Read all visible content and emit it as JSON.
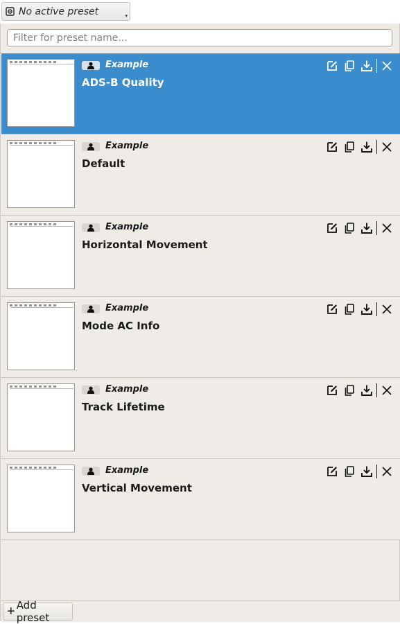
{
  "header": {
    "active_preset_label": "No active preset",
    "combo_icon": "gear-icon",
    "combo_arrow": "▾"
  },
  "filter": {
    "placeholder": "Filter for preset name...",
    "value": ""
  },
  "presets": [
    {
      "tag": "Example",
      "name": "ADS-B Quality",
      "selected": true
    },
    {
      "tag": "Example",
      "name": "Default",
      "selected": false
    },
    {
      "tag": "Example",
      "name": "Horizontal Movement",
      "selected": false
    },
    {
      "tag": "Example",
      "name": "Mode AC Info",
      "selected": false
    },
    {
      "tag": "Example",
      "name": "Track Lifetime",
      "selected": false
    },
    {
      "tag": "Example",
      "name": "Vertical Movement",
      "selected": false
    }
  ],
  "row_icons": [
    "user-icon",
    "edit-icon",
    "copy-icon",
    "download-icon",
    "close-icon"
  ],
  "footer": {
    "add_label": "Add preset",
    "add_icon": "+"
  },
  "colors": {
    "selected_row": "#3a8ccd",
    "panel_bg": "#efebe7"
  }
}
